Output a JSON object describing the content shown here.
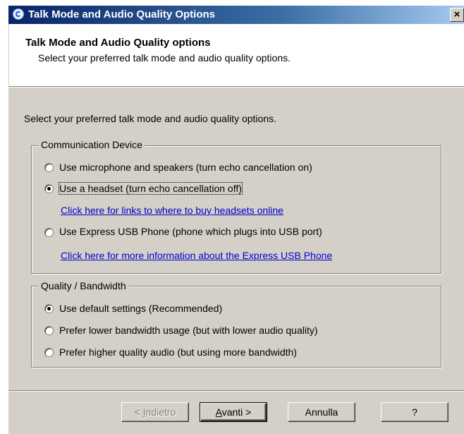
{
  "window": {
    "title": "Talk Mode and Audio Quality Options",
    "close_label": "×"
  },
  "header": {
    "title": "Talk Mode and Audio Quality options",
    "subtitle": "Select your preferred talk mode and audio quality options."
  },
  "intro": "Select your preferred talk mode and audio quality options.",
  "communication": {
    "legend": "Communication Device",
    "options": [
      {
        "label": "Use microphone and speakers (turn echo cancellation on)",
        "checked": false
      },
      {
        "label": "Use a headset (turn echo cancellation off)",
        "checked": true
      },
      {
        "label": "Use Express USB Phone (phone which plugs into USB port)",
        "checked": false
      }
    ],
    "headset_link": "Click here for links to where to buy headsets online",
    "usb_link": "Click here for more information about the Express USB Phone"
  },
  "quality": {
    "legend": "Quality / Bandwidth",
    "options": [
      {
        "label": "Use default settings (Recommended)",
        "checked": true
      },
      {
        "label": "Prefer lower bandwidth usage (but with lower audio quality)",
        "checked": false
      },
      {
        "label": "Prefer higher quality audio (but using more bandwidth)",
        "checked": false
      }
    ]
  },
  "buttons": {
    "back_prefix": "< ",
    "back_mnemonic": "I",
    "back_rest": "ndietro",
    "next_mnemonic": "A",
    "next_rest": "vanti >",
    "cancel": "Annulla",
    "help": "?"
  }
}
